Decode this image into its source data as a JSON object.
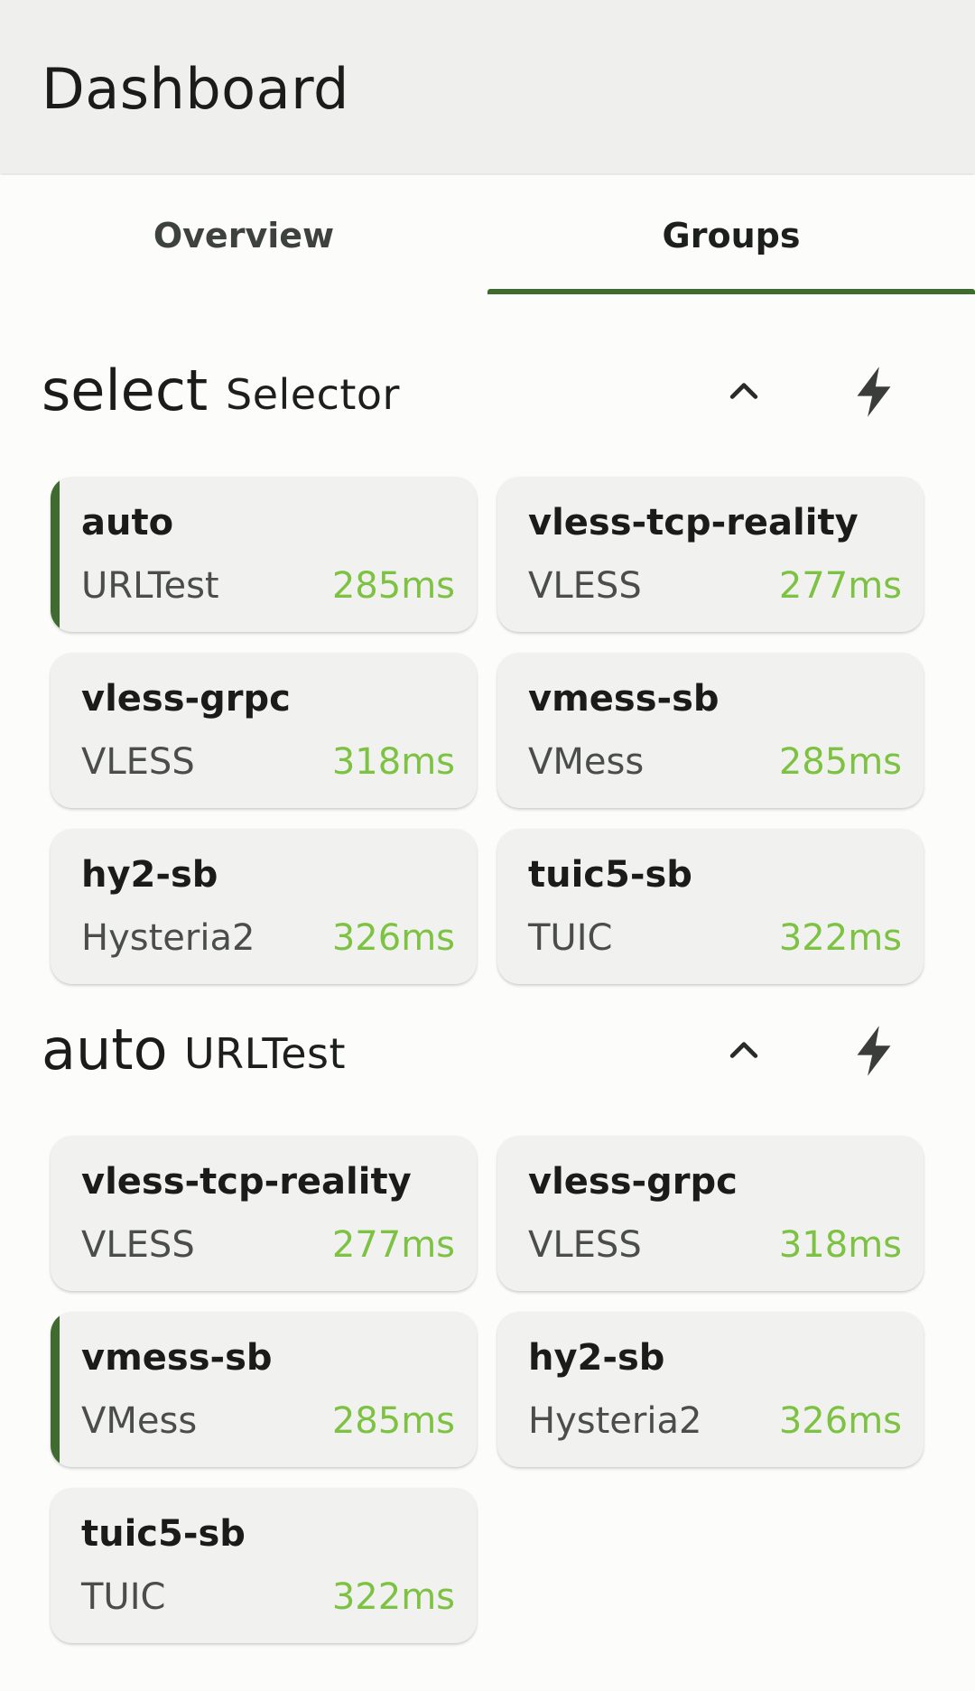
{
  "app_bar": {
    "title": "Dashboard"
  },
  "tabs": [
    {
      "label": "Overview",
      "active": false
    },
    {
      "label": "Groups",
      "active": true
    }
  ],
  "colors": {
    "accent": "#3f6a30",
    "delay_good": "#7dc242",
    "card_bg": "#f1f2ef"
  },
  "groups": [
    {
      "name": "select",
      "type": "Selector",
      "collapse_icon": "chevron-up-icon",
      "test_icon": "lightning-bolt-icon",
      "items": [
        {
          "name": "auto",
          "type": "URLTest",
          "delay": "285ms",
          "selected": true
        },
        {
          "name": "vless-tcp-reality",
          "type": "VLESS",
          "delay": "277ms",
          "selected": false
        },
        {
          "name": "vless-grpc",
          "type": "VLESS",
          "delay": "318ms",
          "selected": false
        },
        {
          "name": "vmess-sb",
          "type": "VMess",
          "delay": "285ms",
          "selected": false
        },
        {
          "name": "hy2-sb",
          "type": "Hysteria2",
          "delay": "326ms",
          "selected": false
        },
        {
          "name": "tuic5-sb",
          "type": "TUIC",
          "delay": "322ms",
          "selected": false
        }
      ]
    },
    {
      "name": "auto",
      "type": "URLTest",
      "collapse_icon": "chevron-up-icon",
      "test_icon": "lightning-bolt-icon",
      "items": [
        {
          "name": "vless-tcp-reality",
          "type": "VLESS",
          "delay": "277ms",
          "selected": false
        },
        {
          "name": "vless-grpc",
          "type": "VLESS",
          "delay": "318ms",
          "selected": false
        },
        {
          "name": "vmess-sb",
          "type": "VMess",
          "delay": "285ms",
          "selected": true
        },
        {
          "name": "hy2-sb",
          "type": "Hysteria2",
          "delay": "326ms",
          "selected": false
        },
        {
          "name": "tuic5-sb",
          "type": "TUIC",
          "delay": "322ms",
          "selected": false
        }
      ]
    }
  ]
}
